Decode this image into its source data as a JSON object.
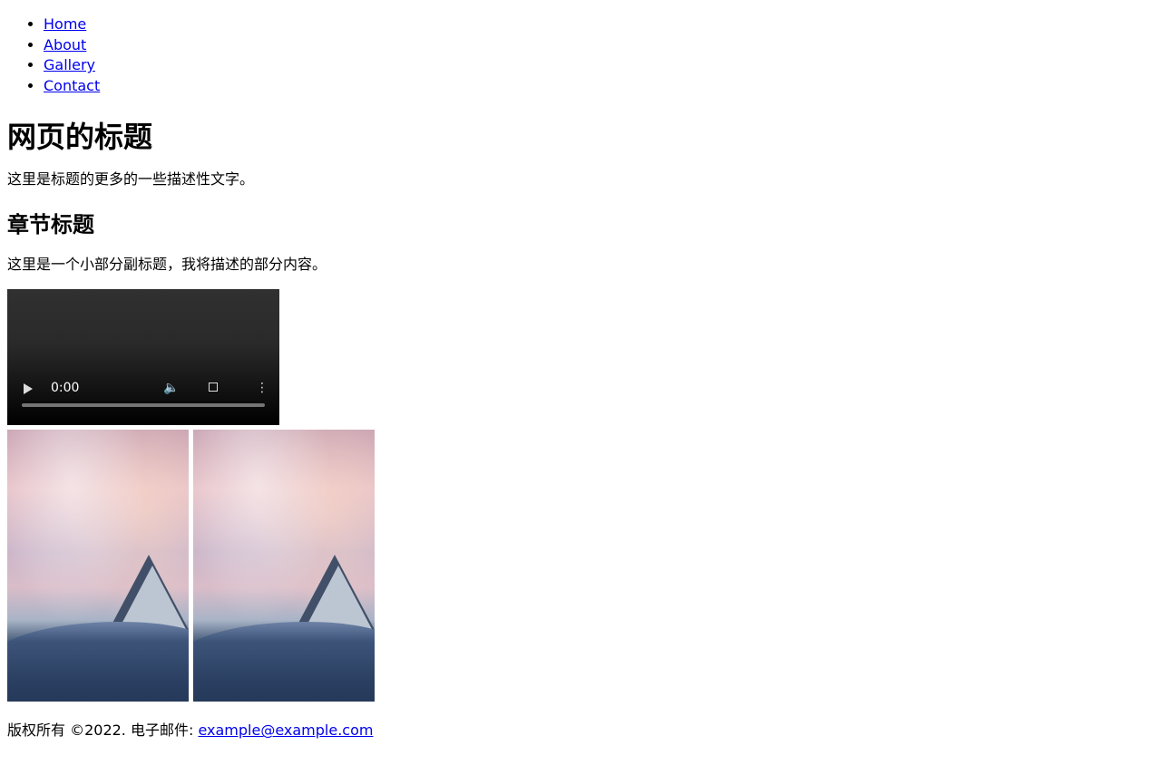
{
  "nav": {
    "items": [
      {
        "label": "Home"
      },
      {
        "label": "About"
      },
      {
        "label": "Gallery"
      },
      {
        "label": "Contact"
      }
    ]
  },
  "header": {
    "title": "网页的标题",
    "subtitle": "这里是标题的更多的一些描述性文字。"
  },
  "section": {
    "title": "章节标题",
    "description": "这里是一个小部分副标题，我将描述的部分内容。"
  },
  "video": {
    "time": "0:00",
    "play_icon": "play-icon",
    "volume_icon": "volume-icon",
    "fullscreen_icon": "fullscreen-icon",
    "more_icon": "more-vertical-icon"
  },
  "gallery": {
    "images": [
      {
        "alt": ""
      },
      {
        "alt": ""
      }
    ]
  },
  "footer": {
    "text": "版权所有 ©2022. 电子邮件: ",
    "email": "example@example.com"
  },
  "colors": {
    "link": "#0000ee",
    "text": "#000000",
    "background": "#ffffff"
  }
}
